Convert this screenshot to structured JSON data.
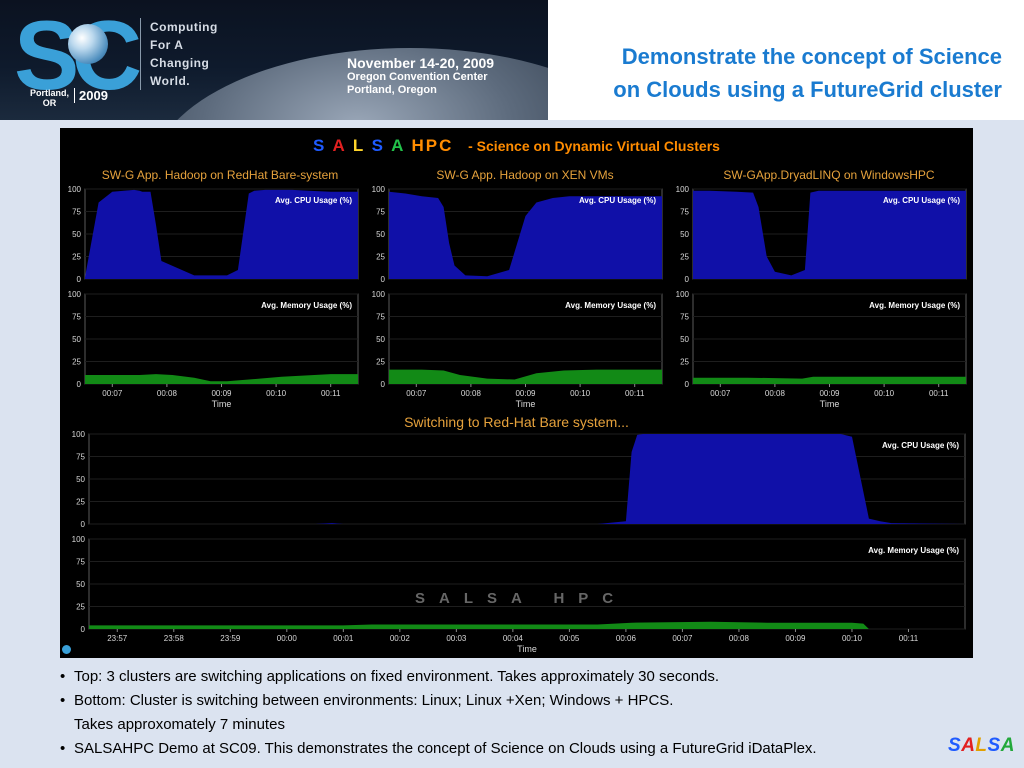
{
  "header": {
    "logo": {
      "year": "2009",
      "location_line1": "Portland,",
      "location_line2": "OR"
    },
    "tagline": [
      "Computing",
      "For A",
      "Changing",
      "World."
    ],
    "event": {
      "dates": "November 14-20, 2009",
      "venue": "Oregon Convention Center",
      "city": "Portland, Oregon"
    },
    "title_line1": "Demonstrate the concept of Science",
    "title_line2": "on Clouds using a FutureGrid cluster"
  },
  "screenshot": {
    "brand_letters": [
      "S",
      "A",
      "L",
      "S",
      "A"
    ],
    "brand_suffix": "HPC",
    "subtitle": "- Science on Dynamic Virtual Clusters",
    "switch_caption": "Switching to Red-Hat Bare system...",
    "watermark": "SALSA HPC",
    "clusters": [
      {
        "title": "SW-G App. Hadoop on RedHat Bare-system"
      },
      {
        "title": "SW-G App. Hadoop on XEN VMs"
      },
      {
        "title": "SW-GApp.DryadLINQ on WindowsHPC"
      }
    ]
  },
  "chart_data": [
    {
      "type": "area",
      "name": "cluster-1-cpu",
      "legend": "Avg. CPU Usage (%)",
      "legend_position": "top-right",
      "ylim": [
        0,
        100
      ],
      "yticks": [
        0,
        25,
        50,
        75,
        100
      ],
      "xlim": [
        0,
        5
      ],
      "color": "#1010a8",
      "x": [
        0,
        0.25,
        0.5,
        0.9,
        1.0,
        1.05,
        1.2,
        1.3,
        1.4,
        2.0,
        2.6,
        2.8,
        3.0,
        3.1,
        3.3,
        3.5,
        3.8,
        4.1,
        4.5,
        5.0
      ],
      "y": [
        2,
        85,
        97,
        99,
        98,
        97,
        97,
        60,
        20,
        4,
        4,
        10,
        95,
        98,
        99,
        99,
        99,
        98,
        97,
        97
      ]
    },
    {
      "type": "area",
      "name": "cluster-1-memory",
      "legend": "Avg. Memory Usage (%)",
      "legend_position": "top-right",
      "ylim": [
        0,
        100
      ],
      "yticks": [
        0,
        25,
        50,
        75,
        100
      ],
      "xlim": [
        0,
        5
      ],
      "xticks": [
        "00:07",
        "00:08",
        "00:09",
        "00:10",
        "00:11"
      ],
      "xlabel": "Time",
      "color": "#128a16",
      "x": [
        0,
        1.0,
        1.3,
        1.6,
        2.0,
        2.3,
        2.6,
        3.0,
        3.6,
        4.2,
        4.5,
        5.0
      ],
      "y": [
        10,
        10,
        11,
        10,
        7,
        3,
        3,
        5,
        8,
        10,
        11,
        11
      ]
    },
    {
      "type": "area",
      "name": "cluster-2-cpu",
      "legend": "Avg. CPU Usage (%)",
      "legend_position": "top-right",
      "ylim": [
        0,
        100
      ],
      "yticks": [
        0,
        25,
        50,
        75,
        100
      ],
      "xlim": [
        0,
        5
      ],
      "color": "#1010a8",
      "x": [
        0,
        0.3,
        0.6,
        0.9,
        1.0,
        1.1,
        1.2,
        1.4,
        1.8,
        2.2,
        2.5,
        2.7,
        3.0,
        3.3,
        3.7,
        4.1,
        4.4,
        4.7,
        5.0
      ],
      "y": [
        97,
        95,
        92,
        90,
        80,
        40,
        15,
        4,
        3,
        10,
        70,
        85,
        90,
        92,
        92,
        92,
        92,
        92,
        92
      ]
    },
    {
      "type": "area",
      "name": "cluster-2-memory",
      "legend": "Avg. Memory Usage (%)",
      "legend_position": "top-right",
      "ylim": [
        0,
        100
      ],
      "yticks": [
        0,
        25,
        50,
        75,
        100
      ],
      "xlim": [
        0,
        5
      ],
      "xticks": [
        "00:07",
        "00:08",
        "00:09",
        "00:10",
        "00:11"
      ],
      "xlabel": "Time",
      "color": "#128a16",
      "x": [
        0,
        0.6,
        1.0,
        1.3,
        1.8,
        2.3,
        2.7,
        3.2,
        3.8,
        4.3,
        4.8,
        5.0
      ],
      "y": [
        16,
        16,
        15,
        10,
        6,
        5,
        12,
        15,
        16,
        16,
        16,
        16
      ]
    },
    {
      "type": "area",
      "name": "cluster-3-cpu",
      "legend": "Avg. CPU Usage (%)",
      "legend_position": "top-right",
      "ylim": [
        0,
        100
      ],
      "yticks": [
        0,
        25,
        50,
        75,
        100
      ],
      "xlim": [
        0,
        5
      ],
      "color": "#1010a8",
      "x": [
        0,
        0.3,
        0.8,
        1.1,
        1.2,
        1.35,
        1.5,
        1.8,
        2.05,
        2.15,
        2.3,
        2.8,
        3.4,
        4.0,
        4.5,
        4.8,
        5.0
      ],
      "y": [
        98,
        98,
        97,
        96,
        80,
        25,
        8,
        4,
        10,
        96,
        98,
        98,
        98,
        98,
        98,
        98,
        98
      ]
    },
    {
      "type": "area",
      "name": "cluster-3-memory",
      "legend": "Avg. Memory Usage (%)",
      "legend_position": "top-right",
      "ylim": [
        0,
        100
      ],
      "yticks": [
        0,
        25,
        50,
        75,
        100
      ],
      "xlim": [
        0,
        5
      ],
      "xticks": [
        "00:07",
        "00:08",
        "00:09",
        "00:10",
        "00:11"
      ],
      "xlabel": "Time",
      "color": "#128a16",
      "x": [
        0,
        1.0,
        2.0,
        2.2,
        3.0,
        4.0,
        5.0
      ],
      "y": [
        7,
        7,
        6,
        8,
        8,
        8,
        8
      ]
    },
    {
      "type": "area",
      "name": "timeline-cpu",
      "legend": "Avg. CPU Usage (%)",
      "legend_position": "top-right",
      "ylim": [
        0,
        100
      ],
      "yticks": [
        0,
        25,
        50,
        75,
        100
      ],
      "xlim": [
        0,
        15.5
      ],
      "color": "#1010a8",
      "x": [
        0,
        4.0,
        4.3,
        4.5,
        9.0,
        9.5,
        9.6,
        9.7,
        9.8,
        10.0,
        13.3,
        13.5,
        13.8,
        14.0,
        14.2,
        15.5
      ],
      "y": [
        0,
        0,
        1,
        0,
        0,
        3,
        80,
        99,
        100,
        100,
        100,
        97,
        6,
        3,
        1,
        0
      ]
    },
    {
      "type": "area",
      "name": "timeline-memory",
      "legend": "Avg. Memory Usage (%)",
      "legend_position": "top-right",
      "ylim": [
        0,
        100
      ],
      "yticks": [
        0,
        25,
        50,
        75,
        100
      ],
      "xlim": [
        0,
        15.5
      ],
      "xticks": [
        "23:57",
        "23:58",
        "23:59",
        "00:00",
        "00:01",
        "00:02",
        "00:03",
        "00:04",
        "00:05",
        "00:06",
        "00:07",
        "00:08",
        "00:09",
        "00:10",
        "00:11"
      ],
      "xlabel": "Time",
      "color": "#128a16",
      "x": [
        0,
        4.5,
        5.0,
        9.0,
        9.6,
        11.0,
        12.0,
        13.5,
        13.7,
        13.8,
        15.5
      ],
      "y": [
        4,
        4,
        5,
        5,
        7,
        8,
        7,
        7,
        6,
        0,
        0
      ]
    }
  ],
  "bullets": [
    "Top: 3 clusters are switching applications on fixed environment. Takes approximately 30 seconds.",
    "Bottom: Cluster is switching between environments: Linux; Linux +Xen; Windows + HPCS.",
    "Takes approxomately 7 minutes",
    "SALSAHPC Demo at SC09. This demonstrates the concept of Science on Clouds using a FutureGrid iDataPlex."
  ],
  "footer_logo": [
    "S",
    "A",
    "L",
    "S",
    "A"
  ]
}
